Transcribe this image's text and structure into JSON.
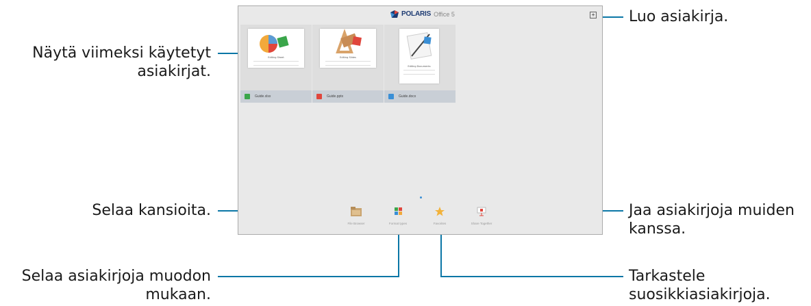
{
  "callouts": {
    "recent": [
      "Näytä viimeksi käytetyt",
      "asiakirjat."
    ],
    "create": "Luo asiakirja.",
    "browse_folders": "Selaa kansioita.",
    "share": [
      "Jaa asiakirjoja muiden",
      "kanssa."
    ],
    "browse_format": [
      "Selaa asiakirjoja muodon",
      "mukaan."
    ],
    "favorites": [
      "Tarkastele",
      "suosikkiasiakirjoja."
    ]
  },
  "app": {
    "logo_text": "POLARIS",
    "logo_sub": "Office 5",
    "new_doc_icon": "+"
  },
  "recent_files": [
    {
      "name": "Guide.xlsx",
      "thumb_title": "Editing Sheet",
      "icon": "spreadsheet-icon",
      "color": "#3aa64a"
    },
    {
      "name": "Guide.pptx",
      "thumb_title": "Editing Slides",
      "icon": "presentation-icon",
      "color": "#e0463c"
    },
    {
      "name": "Guide.docx",
      "thumb_title": "Editing Documents",
      "icon": "document-icon",
      "color": "#3a8fd6"
    }
  ],
  "bottom_nav": [
    {
      "label": "File Browser",
      "icon": "folder-icon"
    },
    {
      "label": "Format types",
      "icon": "grid-icon"
    },
    {
      "label": "Favorites",
      "icon": "star-icon"
    },
    {
      "label": "Share Together",
      "icon": "presentation-share-icon"
    }
  ],
  "colors": {
    "callout_line": "#0a76a6",
    "screen_bg": "#e9e9e9",
    "card_bar": "#c9cfd6",
    "logo_navy": "#1c3a72"
  }
}
